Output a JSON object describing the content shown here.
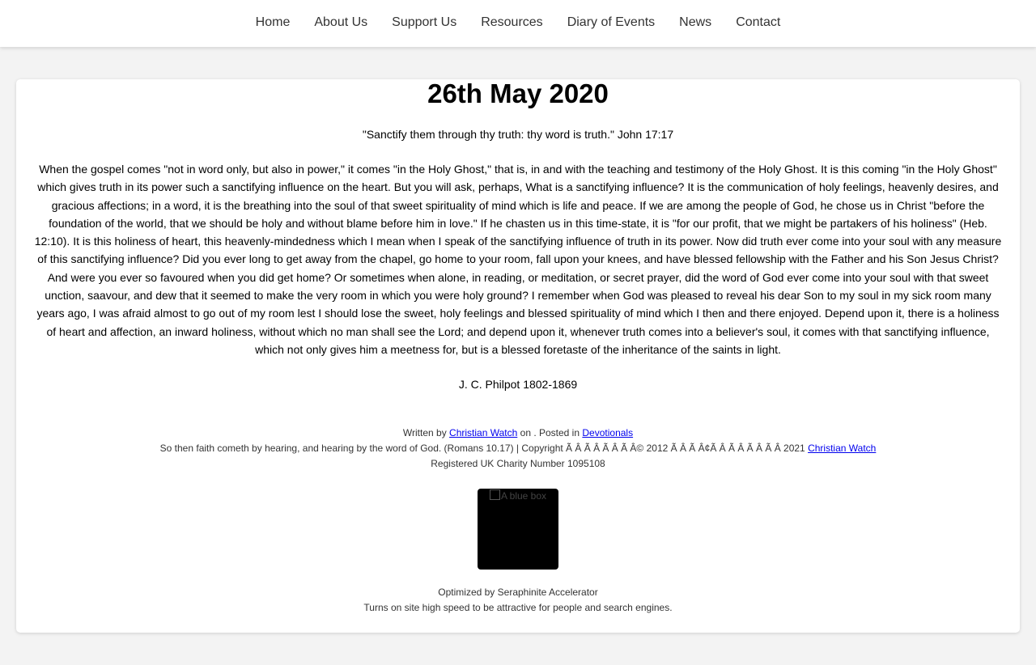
{
  "nav": {
    "items": [
      "Home",
      "About Us",
      "Support Us",
      "Resources",
      "Diary of Events",
      "News",
      "Contact"
    ]
  },
  "post": {
    "title": "26th May 2020",
    "verse": "\"Sanctify them through thy truth: thy word is truth.\" John 17:17",
    "body": "When the gospel comes \"not in word only, but also in power,\" it comes \"in the Holy Ghost,\" that is, in and with the teaching and testimony of the Holy Ghost. It is this coming \"in the Holy Ghost\" which gives truth in its power such a sanctifying influence on the heart. But you will ask, perhaps, What is a sanctifying influence? It is the communication of holy feelings, heavenly desires, and gracious affections; in a word, it is the breathing into the soul of that sweet spirituality of mind which is life and peace. If we are among the people of God, he chose us in Christ \"before the foundation of the world, that we should be holy and without blame before him in love.\" If he chasten us in this time-state, it is \"for our profit, that we might be partakers of his holiness\" (Heb. 12:10). It is this holiness of heart, this heavenly-mindedness which I mean when I speak of the sanctifying influence of truth in its power. Now did truth ever come into your soul with any measure of this sanctifying influence? Did you ever long to get away from the chapel, go home to your room, fall upon your knees, and have blessed fellowship with the Father and his Son Jesus Christ? And were you ever so favoured when you did get home? Or sometimes when alone, in reading, or meditation, or secret prayer, did the word of God ever come into your soul with that sweet unction, saavour, and dew that it seemed to make the very room in which you were holy ground? I remember when God was pleased to reveal his dear Son to my soul in my sick room many years ago, I was afraid almost to go out of my room lest I should lose the sweet, holy feelings and blessed spirituality of mind which I then and there enjoyed. Depend upon it, there is a holiness of heart and affection, an inward holiness, without which no man shall see the Lord; and depend upon it, whenever truth comes into a believer's soul, it comes with that sanctifying influence, which not only gives him a meetness for, but is a blessed foretaste of the inheritance of the saints in light.",
    "author": "J. C. Philpot 1802-1869"
  },
  "footer": {
    "written_by_prefix": "Written by",
    "written_by_link": "Christian Watch",
    "posted_in_middle": "on . Posted in",
    "category_link": "Devotionals",
    "copyright_text": "So then faith cometh by hearing, and hearing by the word of God. (Romans 10.17) | Copyright Ã   Â   Ã   Â   Ã   Â   Ã   Â© 2012 Ã   Â   Ã   Â¢Ã   Â   Ã   Â   Ã   Â   Ã   Â    2021",
    "copyright_link": "Christian Watch",
    "charity": "Registered UK Charity Number 1095108",
    "image_alt": "A blue box",
    "optimized_by": "Optimized by Seraphinite Accelerator",
    "optimized_tagline": "Turns on site high speed to be attractive for people and search engines."
  }
}
